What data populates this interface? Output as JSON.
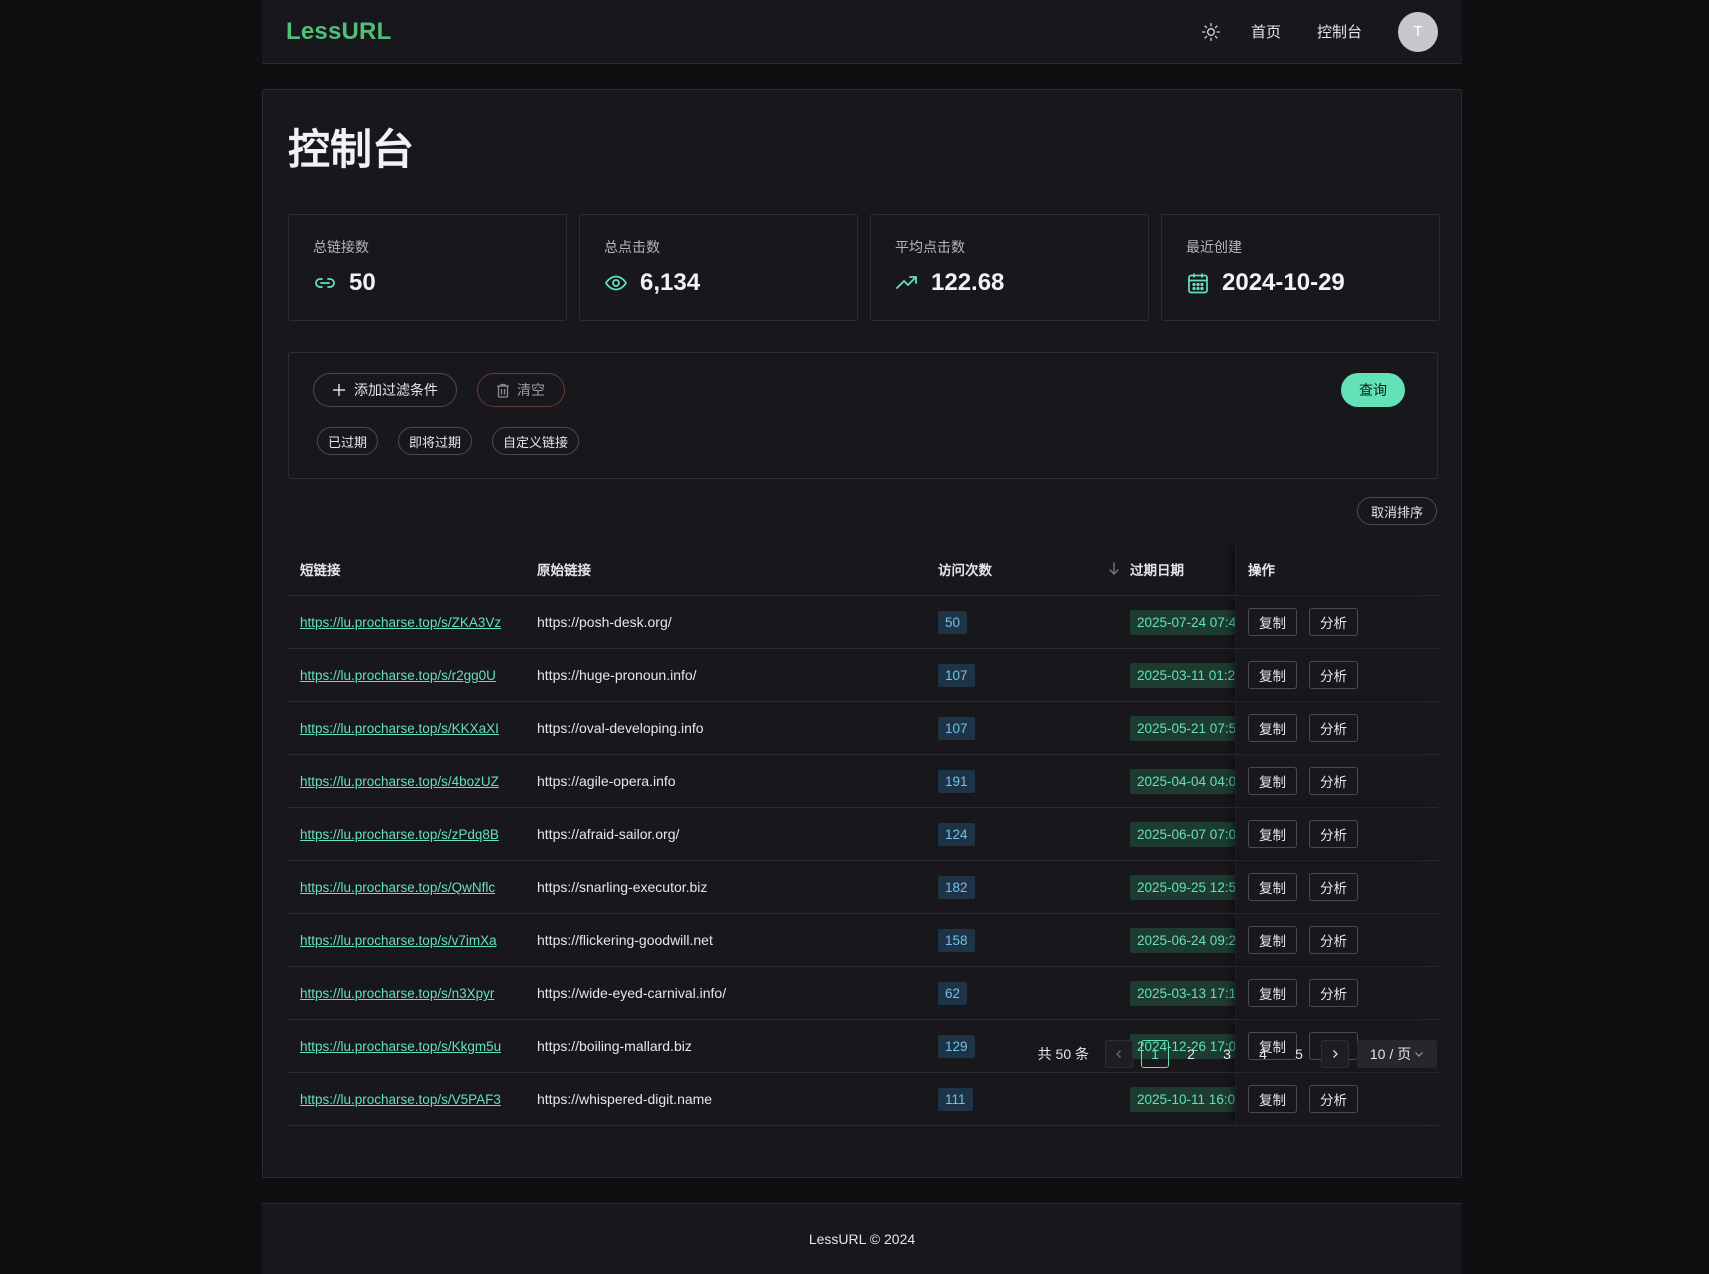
{
  "header": {
    "logo": "LessURL",
    "nav": [
      "首页",
      "控制台"
    ],
    "avatar_initial": "T"
  },
  "page_title": "控制台",
  "stats": [
    {
      "label": "总链接数",
      "value": "50",
      "icon": "link-icon"
    },
    {
      "label": "总点击数",
      "value": "6,134",
      "icon": "eye-icon"
    },
    {
      "label": "平均点击数",
      "value": "122.68",
      "icon": "trending-up-icon"
    },
    {
      "label": "最近创建",
      "value": "2024-10-29",
      "icon": "calendar-icon"
    }
  ],
  "filters": {
    "add_label": "添加过滤条件",
    "clear_label": "清空",
    "query_label": "查询",
    "chips": [
      "已过期",
      "即将过期",
      "自定义链接"
    ]
  },
  "unsort_label": "取消排序",
  "table": {
    "headers": [
      "短链接",
      "原始链接",
      "访问次数",
      "过期日期",
      "操作"
    ],
    "copy_label": "复制",
    "analyze_label": "分析",
    "rows": [
      {
        "short": "https://lu.procharse.top/s/ZKA3Vz",
        "original": "https://posh-desk.org/",
        "visits": "50",
        "expiry": "2025-07-24 07:4"
      },
      {
        "short": "https://lu.procharse.top/s/r2gg0U",
        "original": "https://huge-pronoun.info/",
        "visits": "107",
        "expiry": "2025-03-11 01:2"
      },
      {
        "short": "https://lu.procharse.top/s/KKXaXI",
        "original": "https://oval-developing.info",
        "visits": "107",
        "expiry": "2025-05-21 07:5"
      },
      {
        "short": "https://lu.procharse.top/s/4bozUZ",
        "original": "https://agile-opera.info",
        "visits": "191",
        "expiry": "2025-04-04 04:0"
      },
      {
        "short": "https://lu.procharse.top/s/zPdq8B",
        "original": "https://afraid-sailor.org/",
        "visits": "124",
        "expiry": "2025-06-07 07:0"
      },
      {
        "short": "https://lu.procharse.top/s/QwNflc",
        "original": "https://snarling-executor.biz",
        "visits": "182",
        "expiry": "2025-09-25 12:5"
      },
      {
        "short": "https://lu.procharse.top/s/v7imXa",
        "original": "https://flickering-goodwill.net",
        "visits": "158",
        "expiry": "2025-06-24 09:2"
      },
      {
        "short": "https://lu.procharse.top/s/n3Xpyr",
        "original": "https://wide-eyed-carnival.info/",
        "visits": "62",
        "expiry": "2025-03-13 17:1"
      },
      {
        "short": "https://lu.procharse.top/s/Kkgm5u",
        "original": "https://boiling-mallard.biz",
        "visits": "129",
        "expiry": "2024-12-26 17:0"
      },
      {
        "short": "https://lu.procharse.top/s/V5PAF3",
        "original": "https://whispered-digit.name",
        "visits": "111",
        "expiry": "2025-10-11 16:0"
      }
    ]
  },
  "pagination": {
    "total": "共 50 条",
    "pages": [
      "1",
      "2",
      "3",
      "4",
      "5"
    ],
    "current": "1",
    "page_size": "10 / 页"
  },
  "footer": "LessURL © 2024",
  "colors": {
    "accent": "#63e2b7",
    "logo": "#4fbf7a",
    "info": "#70c0e8",
    "background": "#0f0f12",
    "surface": "#18181c"
  }
}
